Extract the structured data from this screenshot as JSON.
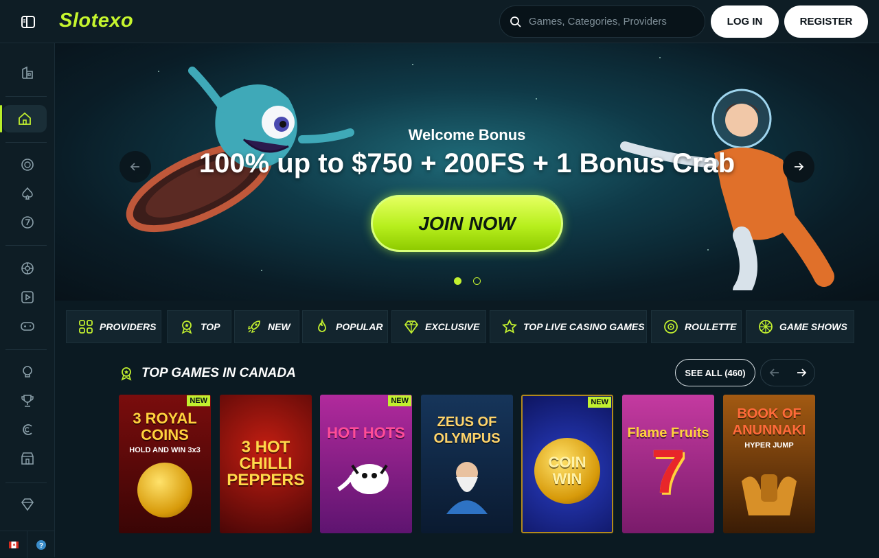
{
  "header": {
    "logo": "Slotexo",
    "search_placeholder": "Games, Categories, Providers",
    "login_label": "LOG IN",
    "register_label": "REGISTER"
  },
  "sidebar": {
    "icons": [
      "casino-building-icon",
      "home-icon",
      "chip-icon",
      "spade-icon",
      "seven-icon",
      "roulette-icon",
      "play-icon",
      "gamepad-icon",
      "lightbulb-icon",
      "trophy-icon",
      "promo-icon",
      "shop-icon",
      "diamond-icon"
    ],
    "active": "home-icon"
  },
  "hero": {
    "subtitle": "Welcome Bonus",
    "title": "100% up to $750 + 200FS + 1 Bonus Crab",
    "cta_label": "JOIN NOW",
    "slide_count": 2,
    "active_slide": 1
  },
  "categories": [
    {
      "label": "PROVIDERS",
      "icon": "grid-icon"
    },
    {
      "label": "TOP",
      "icon": "medal-icon"
    },
    {
      "label": "NEW",
      "icon": "rocket-icon"
    },
    {
      "label": "POPULAR",
      "icon": "flame-icon"
    },
    {
      "label": "EXCLUSIVE",
      "icon": "diamond-icon"
    },
    {
      "label": "TOP LIVE CASINO GAMES",
      "icon": "star-icon"
    },
    {
      "label": "ROULETTE",
      "icon": "roulette-icon"
    },
    {
      "label": "GAME SHOWS",
      "icon": "wheel-icon"
    }
  ],
  "top_games": {
    "title": "TOP GAMES IN CANADA",
    "see_all_label": "SEE ALL (460)",
    "games": [
      {
        "title": "3 ROYAL COINS",
        "subtitle": "HOLD AND WIN 3x3",
        "badge": "NEW"
      },
      {
        "title": "3 HOT CHILLI PEPPERS",
        "subtitle": "",
        "badge": ""
      },
      {
        "title": "HOT HOTS",
        "subtitle": "",
        "badge": "NEW"
      },
      {
        "title": "ZEUS OF OLYMPUS",
        "subtitle": "",
        "badge": ""
      },
      {
        "title": "COIN WIN",
        "subtitle": "",
        "badge": "NEW"
      },
      {
        "title": "Flame Fruits",
        "subtitle": "",
        "badge": ""
      },
      {
        "title": "BOOK OF ANUNNAKI",
        "subtitle": "HYPER JUMP",
        "badge": ""
      }
    ]
  },
  "colors": {
    "accent": "#c2f02f",
    "background": "#0b1a22",
    "sidebar": "#0e1d25"
  }
}
